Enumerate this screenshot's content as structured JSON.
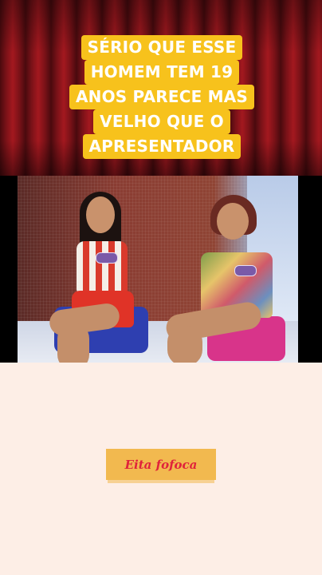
{
  "caption": {
    "lines": [
      "SÉRIO QUE ESSE",
      "HOMEM TEM 19",
      "ANOS PARECE MAS",
      "VELHO QUE O",
      "APRESENTADOR"
    ]
  },
  "brand": {
    "label": "Eita fofoca"
  },
  "colors": {
    "caption_bg": "#f7c21c",
    "caption_text": "#ffffff",
    "curtain": "#a3181f",
    "page_bg": "#fdeee6",
    "brand_bg": "#f2b94f",
    "brand_text": "#e0233b"
  }
}
